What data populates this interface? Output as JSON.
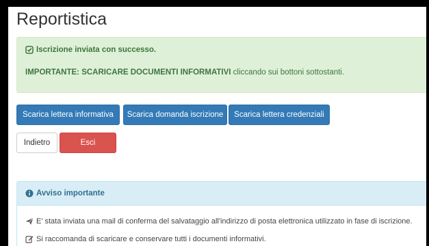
{
  "page": {
    "title": "Reportistica"
  },
  "success_alert": {
    "message": "Iscrizione inviata con successo.",
    "important_label": "IMPORTANTE: SCARICARE DOCUMENTI INFORMATIVI",
    "important_text": " cliccando sui bottoni sottostanti."
  },
  "download_buttons": [
    {
      "label": "Scarica lettera informativa"
    },
    {
      "label": "Scarica domanda iscrizione"
    },
    {
      "label": "Scarica lettera credenziali"
    }
  ],
  "nav_buttons": {
    "back_label": "Indietro",
    "exit_label": "Esci"
  },
  "notice_panel": {
    "heading": "Avviso importante",
    "lines": [
      "E' stata inviata una mail di conferma del salvataggio all'indirizzo di posta elettronica utilizzato in fase di iscrizione.",
      "Si raccomanda di scaricare e conservare tutti i documenti informativi."
    ]
  },
  "colors": {
    "primary": "#337ab7",
    "danger": "#d9534f",
    "success_bg": "#dff0d8",
    "success_text": "#3c763d",
    "info_bg": "#d9edf7",
    "info_text": "#31708f"
  },
  "icons": {
    "success": "check-square-icon",
    "info": "info-circle-icon",
    "mail": "paper-plane-icon",
    "note": "edit-icon"
  }
}
